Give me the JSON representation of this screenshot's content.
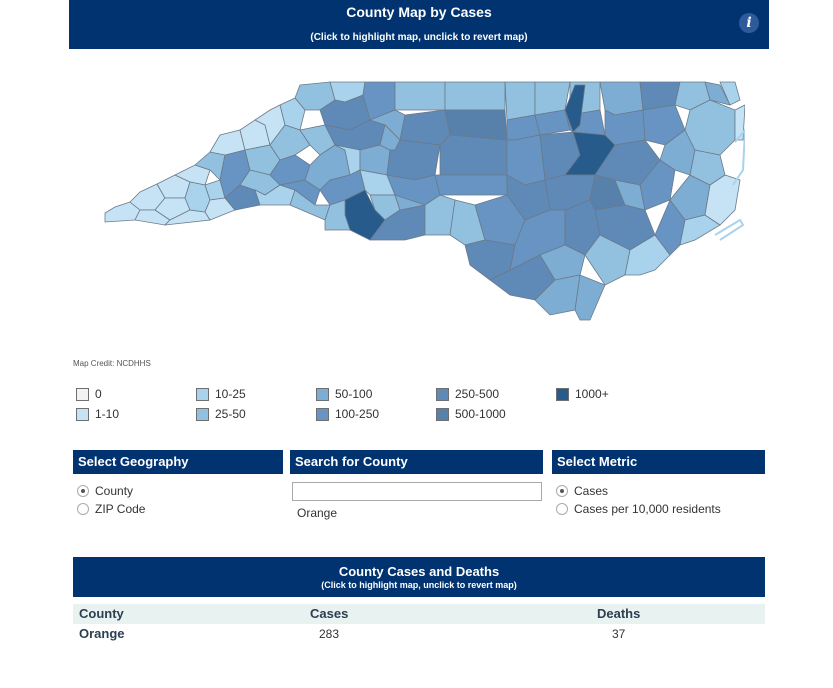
{
  "map_header": {
    "title": "County Map by Cases",
    "subtitle": "(Click to highlight map, unclick to revert map)",
    "info_icon": "info-icon"
  },
  "map": {
    "credit": "Map Credit: NCDHHS",
    "state": "North Carolina",
    "colors": {
      "0": "#f3f3f3",
      "1-10": "#c6e3f5",
      "10-25": "#a9d3ec",
      "25-50": "#92c1e0",
      "50-100": "#7eadd3",
      "100-250": "#6794c2",
      "250-500": "#5f89b6",
      "500-1000": "#5780ab",
      "1000+": "#265b8c"
    }
  },
  "legend": [
    {
      "label": "0",
      "color": "#f3f3f3"
    },
    {
      "label": "1-10",
      "color": "#c6e3f5"
    },
    {
      "label": "10-25",
      "color": "#a9d3ec"
    },
    {
      "label": "25-50",
      "color": "#92c1e0"
    },
    {
      "label": "50-100",
      "color": "#7eadd3"
    },
    {
      "label": "100-250",
      "color": "#6794c2"
    },
    {
      "label": "250-500",
      "color": "#5f89b6"
    },
    {
      "label": "500-1000",
      "color": "#5780ab"
    },
    {
      "label": "1000+",
      "color": "#265b8c"
    }
  ],
  "geography": {
    "heading": "Select Geography",
    "options": [
      {
        "label": "County",
        "checked": true
      },
      {
        "label": "ZIP Code",
        "checked": false
      }
    ]
  },
  "search": {
    "heading": "Search for County",
    "value": "",
    "placeholder": "",
    "result": "Orange"
  },
  "metric": {
    "heading": "Select Metric",
    "options": [
      {
        "label": "Cases",
        "checked": true
      },
      {
        "label": "Cases per 10,000 residents",
        "checked": false
      }
    ]
  },
  "table": {
    "title": "County Cases and Deaths",
    "subtitle": "(Click to highlight map, unclick to revert map)",
    "columns": [
      "County",
      "Cases",
      "Deaths"
    ],
    "rows": [
      {
        "county": "Orange",
        "cases": "283",
        "deaths": "37"
      }
    ]
  }
}
